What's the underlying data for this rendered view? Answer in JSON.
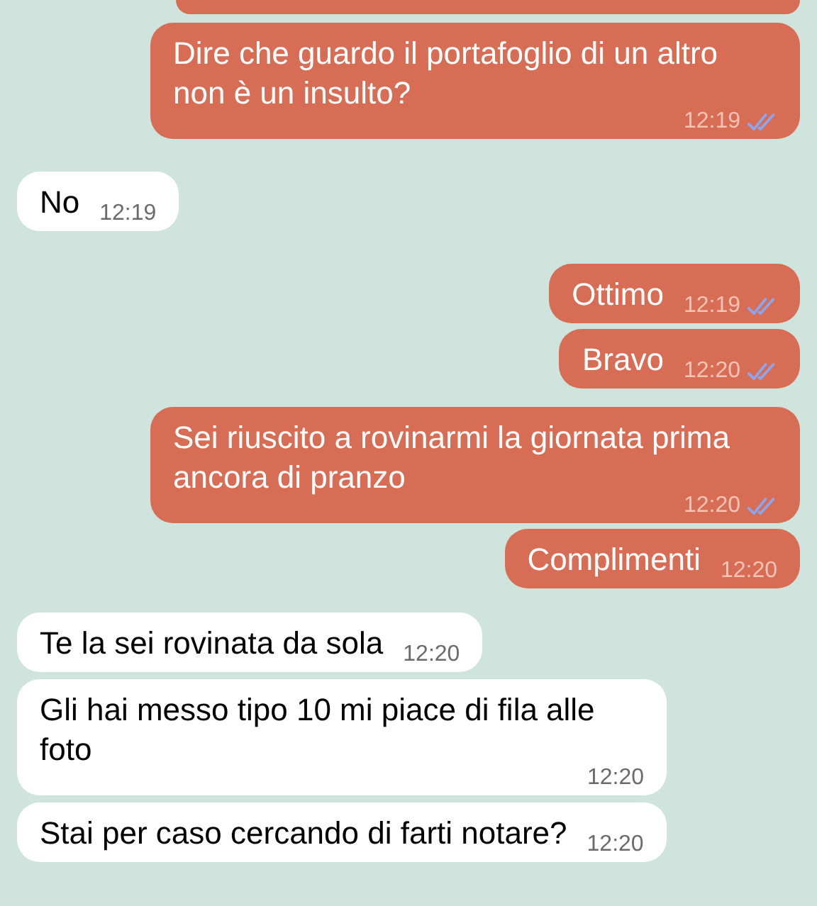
{
  "messages": [
    {
      "kind": "outgoing"
    },
    {
      "kind": "outgoing",
      "text": "Dire che guardo il portafoglio di un altro non è un insulto?",
      "time": "12:19",
      "ticks": true
    },
    {
      "kind": "incoming",
      "text": "No",
      "time": "12:19"
    },
    {
      "kind": "outgoing",
      "text": "Ottimo",
      "time": "12:19",
      "ticks": true
    },
    {
      "kind": "outgoing",
      "text": "Bravo",
      "time": "12:20",
      "ticks": true
    },
    {
      "kind": "outgoing",
      "text": "Sei riuscito a rovinarmi la giornata prima ancora di pranzo",
      "time": "12:20",
      "ticks": true
    },
    {
      "kind": "outgoing",
      "text": "Complimenti",
      "time": "12:20",
      "ticks": false
    },
    {
      "kind": "incoming",
      "text": "Te la sei rovinata da sola",
      "time": "12:20"
    },
    {
      "kind": "incoming",
      "text": "Gli hai messo tipo 10 mi piace di fila alle foto",
      "time": "12:20"
    },
    {
      "kind": "incoming",
      "text": "Stai per caso cercando di farti notare?",
      "time": "12:20"
    }
  ]
}
